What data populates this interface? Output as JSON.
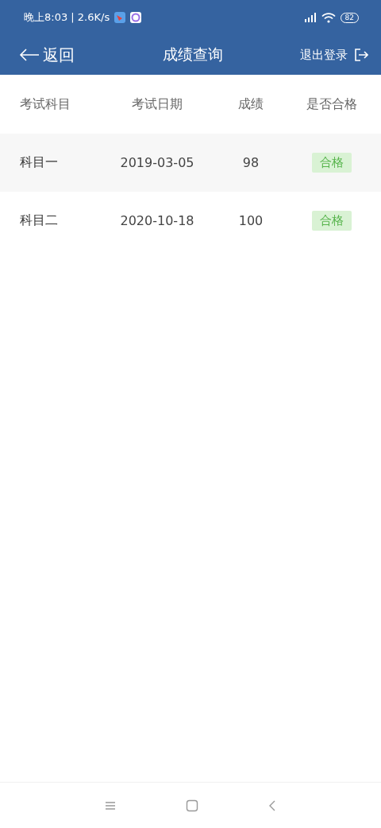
{
  "status_bar": {
    "time": "晚上8:03 | 2.6K/s",
    "battery": "82"
  },
  "header": {
    "back": "返回",
    "title": "成绩查询",
    "logout": "退出登录"
  },
  "table": {
    "columns": [
      "考试科目",
      "考试日期",
      "成绩",
      "是否合格"
    ],
    "rows": [
      {
        "subject": "科目一",
        "date": "2019-03-05",
        "score": "98",
        "result": {
          "text": "合格",
          "kind": "pass"
        }
      },
      {
        "subject": "科目二",
        "date": "2020-10-18",
        "score": "100",
        "result": {
          "text": "合格",
          "kind": "pass"
        }
      }
    ]
  }
}
